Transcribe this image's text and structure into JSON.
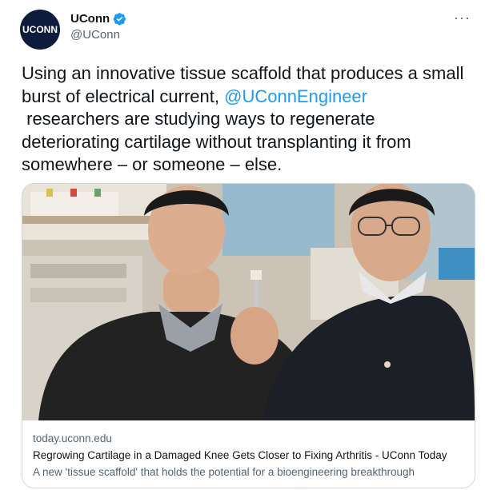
{
  "author": {
    "avatar_text": "UCONN",
    "display_name": "UConn",
    "handle": "@UConn",
    "verified": true
  },
  "more_label": "···",
  "tweet": {
    "text_before": "Using an innovative tissue scaffold that produces a small burst of electrical current, ",
    "mention": "@UConnEngineer",
    "text_after": "\n researchers are studying ways to regenerate deteriorating cartilage without transplanting it from somewhere – or someone – else."
  },
  "card": {
    "image_alt": "Two researchers in a lab, one holding up a small tissue scaffold sample",
    "domain": "today.uconn.edu",
    "title": "Regrowing Cartilage in a Damaged Knee Gets Closer to Fixing Arthritis - UConn Today",
    "description": "A new 'tissue scaffold' that holds the potential for a bioengineering breakthrough"
  },
  "colors": {
    "accent": "#1d9bf0",
    "text": "#0f1419",
    "secondary_text": "#536471",
    "avatar_bg": "#0d1c3d",
    "border": "#cfd9de"
  },
  "icons": [
    "verified-badge-icon",
    "more-options-icon"
  ]
}
